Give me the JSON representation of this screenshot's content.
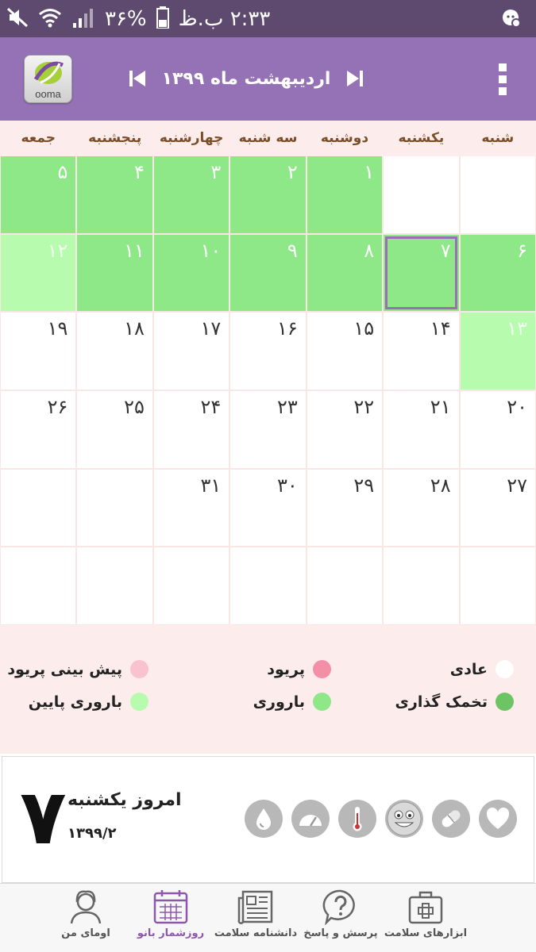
{
  "status_bar": {
    "time": "۲:۳۳ ب.ظ",
    "battery": "۳۶%"
  },
  "header": {
    "month_title": "اردیبهشت ماه ۱۳۹۹",
    "logo_text": "ooma"
  },
  "weekdays": [
    "شنبه",
    "یکشنبه",
    "دوشنبه",
    "سه شنبه",
    "چهارشنبه",
    "پنجشنبه",
    "جمعه"
  ],
  "calendar": {
    "cells": [
      "",
      "",
      "۱",
      "۲",
      "۳",
      "۴",
      "۵",
      "۶",
      "۷",
      "۸",
      "۹",
      "۱۰",
      "۱۱",
      "۱۲",
      "۱۳",
      "۱۴",
      "۱۵",
      "۱۶",
      "۱۷",
      "۱۸",
      "۱۹",
      "۲۰",
      "۲۱",
      "۲۲",
      "۲۳",
      "۲۴",
      "۲۵",
      "۲۶",
      "۲۷",
      "۲۸",
      "۲۹",
      "۳۰",
      "۳۱",
      "",
      "",
      "",
      "",
      "",
      "",
      "",
      "",
      ""
    ]
  },
  "legend": {
    "normal": "عادی",
    "period": "پریود",
    "period_forecast": "پیش بینی پریود",
    "ovulation": "تخمک گذاری",
    "fertile": "باروری",
    "low_fertile": "باروری پایین"
  },
  "today": {
    "big_number": "۷",
    "label": "امروز یکشنبه",
    "date": "۱۳۹۹/۲"
  },
  "bottom_nav": {
    "my_ooma": "اومای من",
    "calendar": "روزشمار بانو",
    "encyclopedia": "دانشنامه سلامت",
    "qa": "پرسش و پاسخ",
    "tools": "ابزارهای سلامت"
  },
  "colors": {
    "header": "#9572b6",
    "fertile": "#8ee888",
    "low_fertile": "#b7fcae",
    "period": "#f48fa8",
    "period_forecast": "#f8c2cf",
    "ovulation": "#6cc464",
    "active_nav": "#8d58ac"
  }
}
